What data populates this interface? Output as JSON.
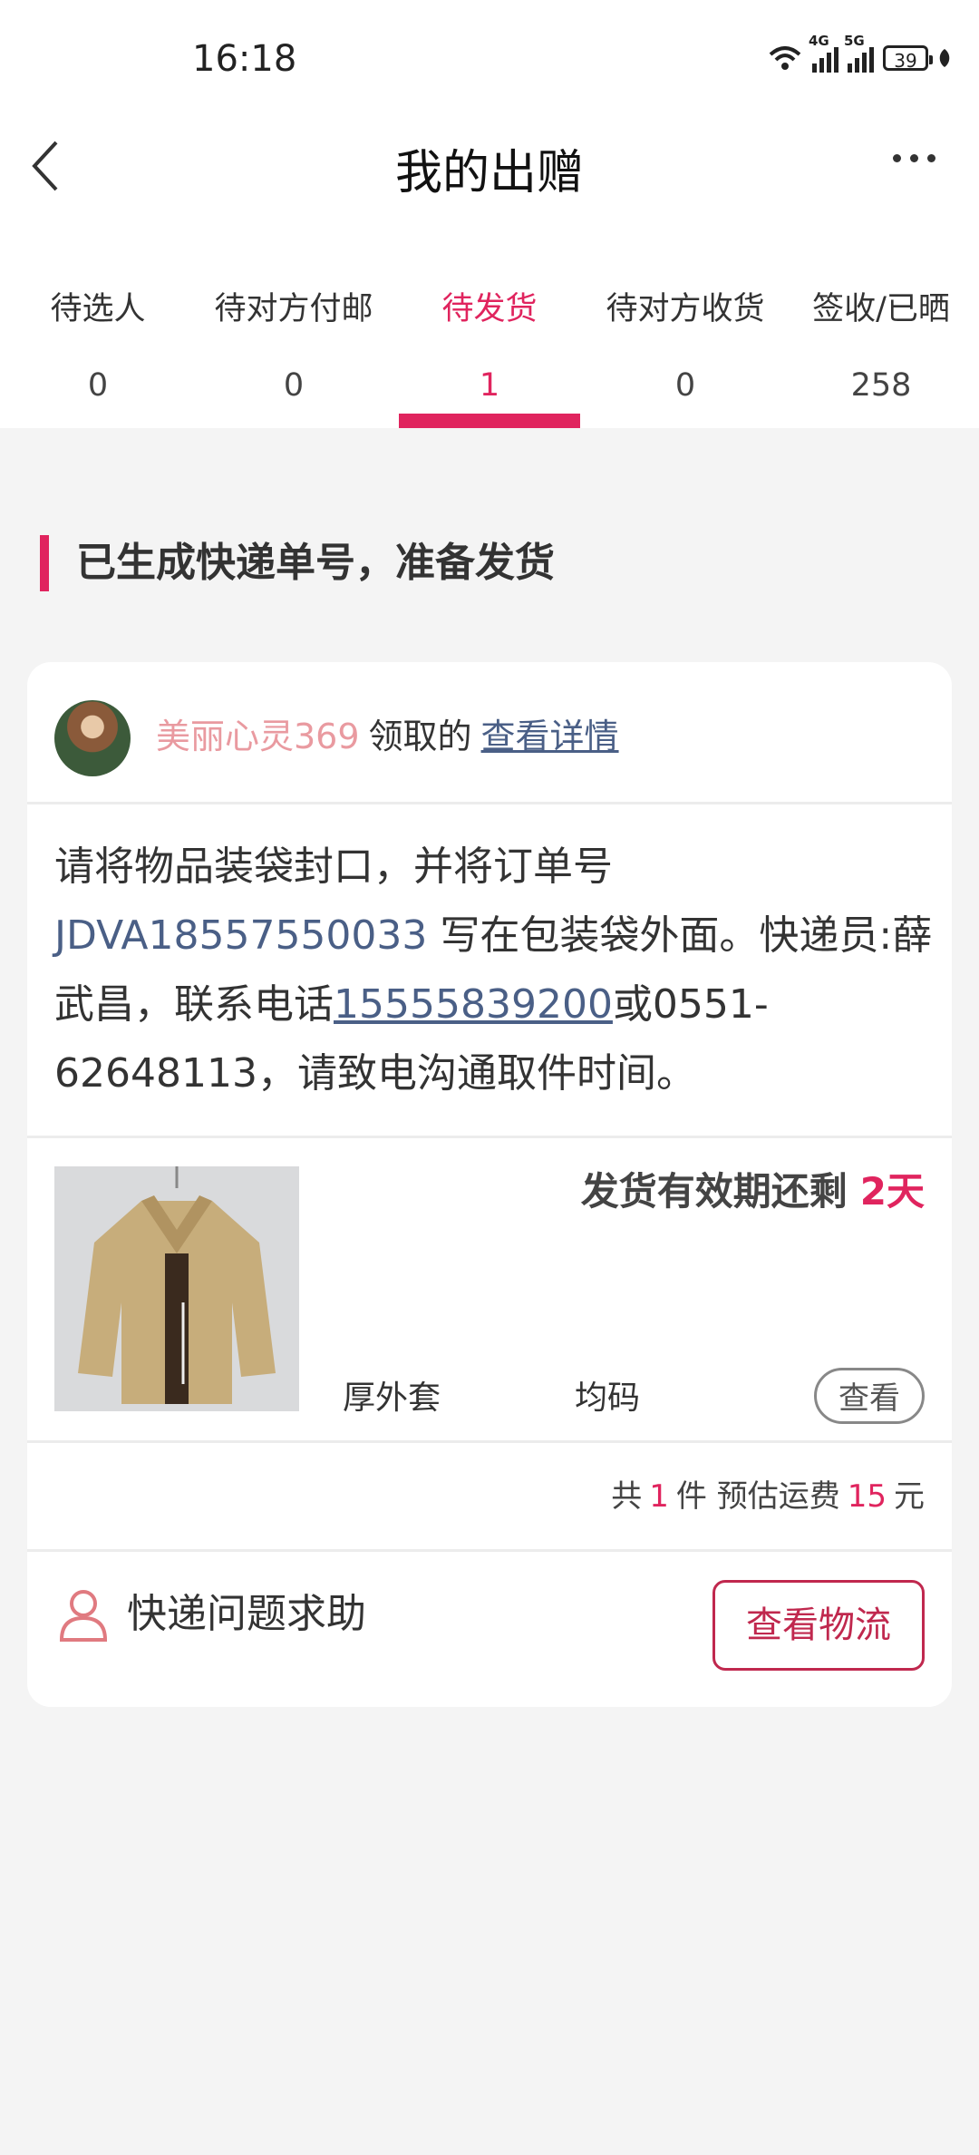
{
  "status_bar": {
    "time": "16:18",
    "battery": "39",
    "net1": "4G",
    "net2": "5G"
  },
  "header": {
    "title": "我的出赠"
  },
  "tabs": [
    {
      "label": "待选人",
      "count": "0"
    },
    {
      "label": "待对方付邮",
      "count": "0"
    },
    {
      "label": "待发货",
      "count": "1"
    },
    {
      "label": "待对方收货",
      "count": "0"
    },
    {
      "label": "签收/已晒",
      "count": "258"
    }
  ],
  "section": {
    "title": "已生成快递单号，准备发货"
  },
  "card": {
    "recipient": "美丽心灵369",
    "claim_verb": "领取的",
    "details_link": "查看详情",
    "instruction": {
      "part1": "请将物品装袋封口，并将订单号 ",
      "order_no": "JDVA18557550033",
      "part2": " 写在包装袋外面。快递员:薛武昌，联系电话",
      "phone1": "15555839200",
      "part3": "或0551-62648113，请致电沟通取件时间。"
    },
    "validity_label": "发货有效期还剩",
    "validity_days": "2天",
    "item_name": "厚外套",
    "item_size": "均码",
    "view_button": "查看",
    "summary": {
      "prefix": "共",
      "count": "1",
      "mid": "件 预估运费",
      "fee": "15",
      "suffix": "元"
    },
    "help_label": "快递问题求助",
    "logistics_button": "查看物流"
  },
  "colors": {
    "accent": "#e0245e",
    "link": "#4a5f86"
  }
}
